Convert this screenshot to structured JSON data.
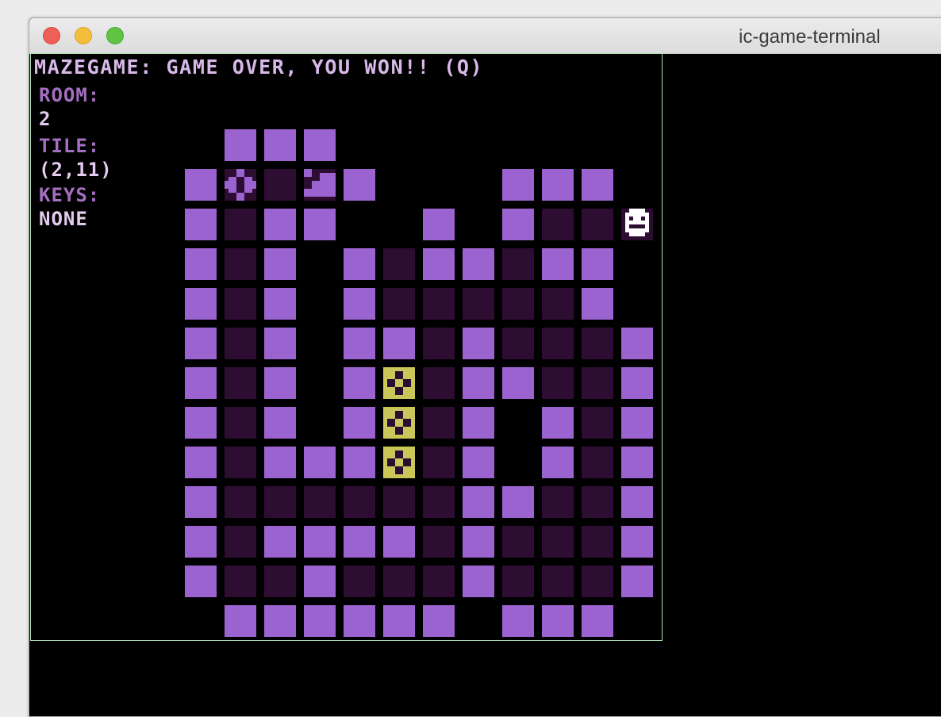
{
  "window": {
    "title": "ic-game-terminal"
  },
  "game": {
    "status_line": "MAZEGAME: GAME OVER, YOU WON!! (Q)",
    "room_label": "ROOM:",
    "room_value": "2",
    "tile_label": "TILE:",
    "tile_value": "(2,11)",
    "keys_label": "KEYS:",
    "keys_value": "NONE"
  },
  "legend": {
    "W": "wall",
    "F": "floor",
    "K": "key",
    "O": "orb",
    "S": "stairs",
    "P": "player",
    ".": "empty"
  },
  "maze_rows": [
    ".WWW........",
    "WOFSW...WWW",
    "WFWW..W.WFFP",
    "WFW.WFWWFWW",
    "WFW.WFFFFFW",
    "WFW.WWFWFFFW",
    "WFW.WKFWWFFW",
    "WFW.WKFW.WFW",
    "WFWWWKFW.WFW",
    "WFFFFFFWWFFW",
    "WFWWWWFWFFFW",
    "WFFWFFFWFFFW",
    ".WWWWWW.WWW."
  ],
  "colors": {
    "wall": "#9b63d0",
    "floor": "#2e0d33",
    "key": "#c9c75a",
    "text_label": "#a56ec0",
    "text_value": "#e4cbef",
    "terminal_border": "#b4e0b4"
  }
}
